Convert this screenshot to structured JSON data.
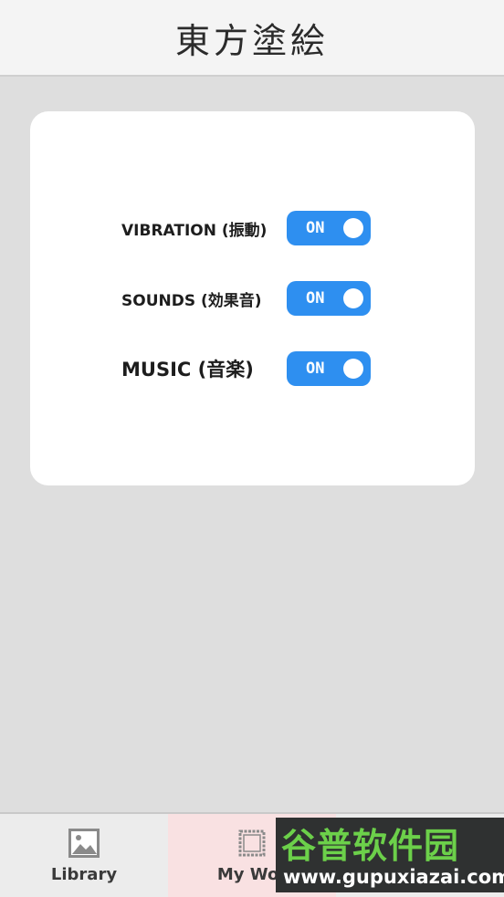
{
  "header": {
    "title": "東方塗絵"
  },
  "settings": {
    "rows": [
      {
        "label": "VIBRATION (振動)",
        "toggle_text": "ON",
        "enabled": true
      },
      {
        "label": "SOUNDS (効果音)",
        "toggle_text": "ON",
        "enabled": true
      },
      {
        "label": "MUSIC (音楽)",
        "toggle_text": "ON",
        "enabled": true
      }
    ],
    "toggle_color": "#2e8ff0"
  },
  "tabbar": {
    "tabs": [
      {
        "label": "Library",
        "icon": "image-icon",
        "selected": false
      },
      {
        "label": "My Wor",
        "icon": "frame-icon",
        "selected": true
      }
    ],
    "selected_color": "#f9e1e2"
  },
  "watermark": {
    "title": "谷普软件园",
    "url": "www.gupuxiazai.com"
  }
}
